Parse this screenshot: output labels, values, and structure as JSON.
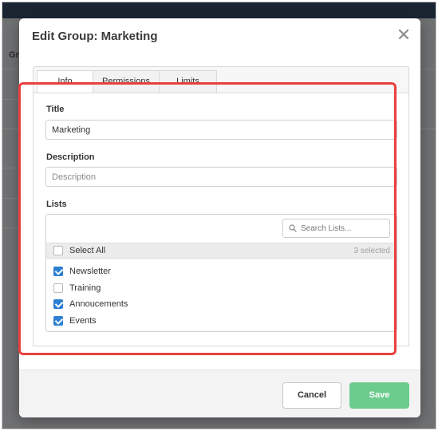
{
  "background": {
    "partial_label": "Gr"
  },
  "modal": {
    "title": "Edit Group: Marketing",
    "close_icon": "close-icon"
  },
  "tabs": [
    {
      "label": "Info",
      "active": true
    },
    {
      "label": "Permissions",
      "active": false
    },
    {
      "label": "Limits",
      "active": false
    }
  ],
  "form": {
    "title_label": "Title",
    "title_value": "Marketing",
    "description_label": "Description",
    "description_value": "",
    "description_placeholder": "Description",
    "lists_label": "Lists",
    "search_placeholder": "Search Lists...",
    "select_all_label": "Select All",
    "selected_count": "3 selected",
    "lists": [
      {
        "label": "Newsletter",
        "checked": true
      },
      {
        "label": "Training",
        "checked": false
      },
      {
        "label": "Annoucements",
        "checked": true
      },
      {
        "label": "Events",
        "checked": true
      }
    ]
  },
  "footer": {
    "cancel_label": "Cancel",
    "save_label": "Save"
  },
  "colors": {
    "accent_checkbox": "#2c7fd1",
    "save_button": "#6ccc8d",
    "highlight_border": "#e8403f",
    "topbar": "#1b2532"
  }
}
